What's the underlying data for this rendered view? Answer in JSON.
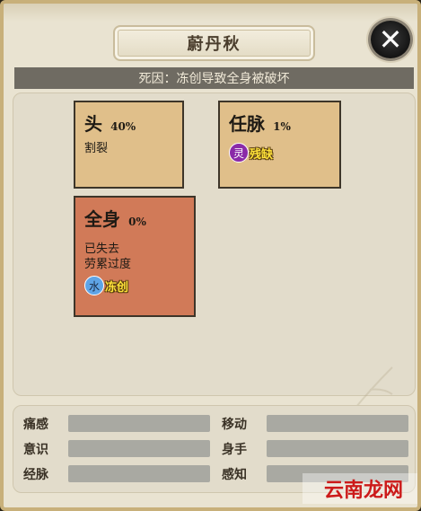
{
  "header": {
    "character_name": "蔚丹秋",
    "close_icon": "close-icon"
  },
  "death_cause": "死因：冻创导致全身被破坏",
  "body_parts": [
    {
      "name": "头",
      "percent": "40%",
      "status_lines": [
        "割裂"
      ],
      "tags": []
    },
    {
      "name": "任脉",
      "percent": "1%",
      "status_lines": [],
      "tags": [
        {
          "badge": "灵",
          "text": "残缺",
          "badge_color": "#8a2aa8"
        }
      ]
    },
    {
      "name": "全身",
      "percent": "0%",
      "status_lines": [
        "已失去",
        "劳累过度"
      ],
      "tags": [
        {
          "badge": "水",
          "text": "冻创",
          "badge_color": "#5fa4e6"
        }
      ]
    }
  ],
  "stats": {
    "labels": [
      "痛感",
      "移动",
      "意识",
      "身手",
      "经脉",
      "感知"
    ]
  },
  "watermark": "云南龙网"
}
